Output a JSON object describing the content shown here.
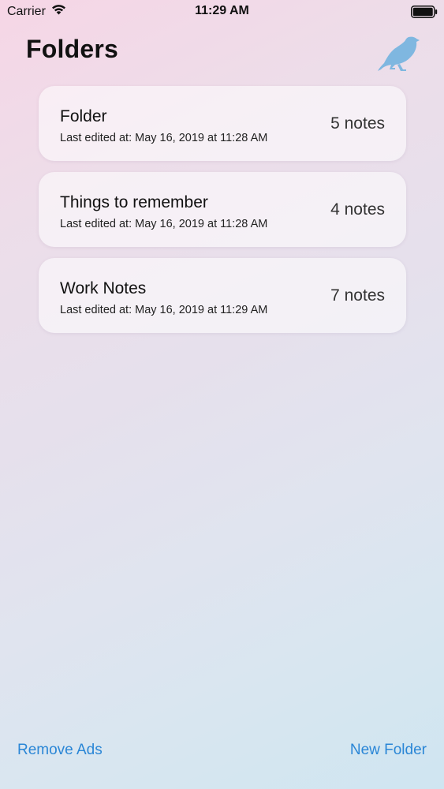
{
  "status_bar": {
    "carrier": "Carrier",
    "time": "11:29 AM"
  },
  "header": {
    "title": "Folders"
  },
  "folders": [
    {
      "name": "Folder",
      "edited": "Last edited at: May 16, 2019 at 11:28 AM",
      "count": "5 notes"
    },
    {
      "name": "Things to remember",
      "edited": "Last edited at: May 16, 2019 at 11:28 AM",
      "count": "4 notes"
    },
    {
      "name": "Work Notes",
      "edited": "Last edited at: May 16, 2019 at 11:29 AM",
      "count": "7 notes"
    }
  ],
  "toolbar": {
    "remove_ads": "Remove Ads",
    "new_folder": "New Folder"
  },
  "icons": {
    "wifi": "wifi-icon",
    "battery": "battery-icon",
    "bird": "bird-icon"
  },
  "colors": {
    "accent": "#2a86d6",
    "bird": "#7fb7e0"
  }
}
